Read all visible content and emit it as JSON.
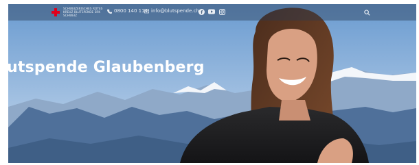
{
  "header": {
    "logo_text": "SCHWEIZERISCHES ROTES KREUZ BLUTSPENDE SRK SCHWEIZ",
    "phone": "0800 140 114",
    "email": "info@blutspende.ch",
    "social_icons": [
      "facebook-icon",
      "youtube-icon",
      "instagram-icon"
    ],
    "search_icon": "search-icon"
  },
  "hero": {
    "title": "utspende Glaubenberg"
  },
  "colors": {
    "sky_top": "#6f9fd0",
    "sky_bottom": "#b9d0e8",
    "mountains": "#4c6e97",
    "snow": "#f3f6fa",
    "brand_red": "#e2001a"
  }
}
